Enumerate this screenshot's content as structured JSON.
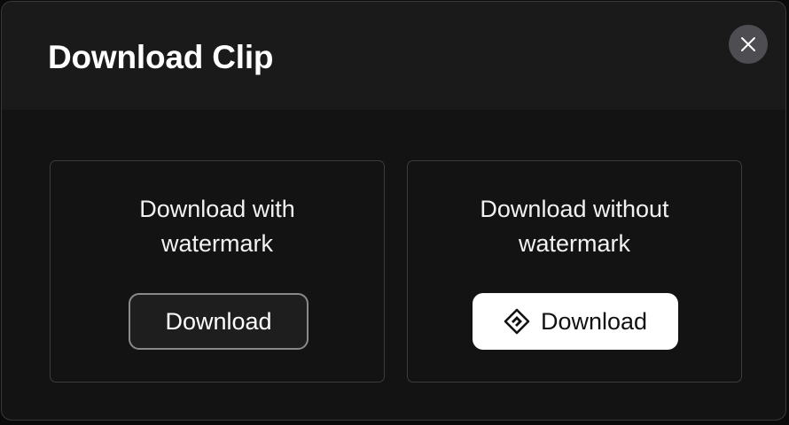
{
  "dialog": {
    "title": "Download Clip",
    "close_icon": "close-icon"
  },
  "options": {
    "with_watermark": {
      "heading_line1": "Download with",
      "heading_line2": "watermark",
      "button_label": "Download"
    },
    "without_watermark": {
      "heading_line1": "Download without",
      "heading_line2": "watermark",
      "button_label": "Download",
      "button_icon": "diamond-icon"
    }
  },
  "colors": {
    "background": "#131313",
    "header": "#1a1a1a",
    "primary_button": "#ffffff",
    "close_button": "#4d4d52"
  }
}
